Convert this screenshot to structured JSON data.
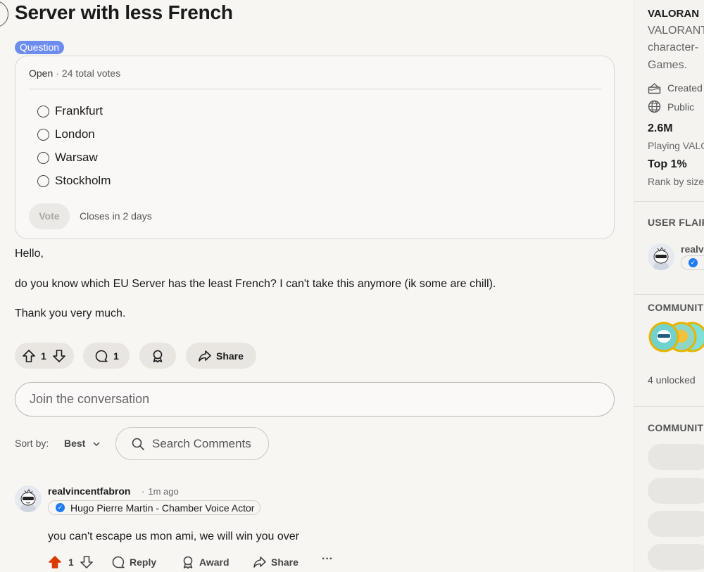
{
  "post": {
    "title": "Server with less French",
    "flair": "Question",
    "poll": {
      "status": "Open",
      "total_votes": "24 total votes",
      "options": [
        "Frankfurt",
        "London",
        "Warsaw",
        "Stockholm"
      ],
      "vote_label": "Vote",
      "closes": "Closes in 2 days"
    },
    "body": [
      "Hello,",
      "do you know which EU Server has the least French? I can't take this anymore (ik some are chill).",
      "Thank you very much."
    ],
    "actions": {
      "upvotes": "1",
      "comments": "1",
      "share_label": "Share"
    }
  },
  "comment_box": {
    "placeholder": "Join the conversation"
  },
  "sort": {
    "label": "Sort by:",
    "value": "Best"
  },
  "search_comments": {
    "label": "Search Comments"
  },
  "comment": {
    "username": "realvincentfabron",
    "time": "1m ago",
    "flair": "Hugo Pierre Martin - Chamber Voice Actor",
    "text": "you can't escape us mon ami, we will win you over",
    "votes": "1",
    "reply_label": "Reply",
    "award_label": "Award",
    "share_label": "Share"
  },
  "sidebar": {
    "community_name": "VALORAN",
    "description_lines": [
      "VALORANT",
      "character-",
      "Games."
    ],
    "created_label": "Created",
    "visibility": "Public",
    "members": "2.6M",
    "members_label": "Playing VALO",
    "rank": "Top 1%",
    "rank_label": "Rank by size",
    "user_flair_heading": "USER FLAIR",
    "user_flair_name": "realv",
    "achievements_heading": "COMMUNIT",
    "unlocked": "4 unlocked",
    "bookmarks_heading": "COMMUNIT"
  },
  "colors": {
    "flair": "#6c8cf0",
    "upvote_active": "#d93a00",
    "verified_badge": "#1d7cf2",
    "background": "#f7f6f3"
  }
}
